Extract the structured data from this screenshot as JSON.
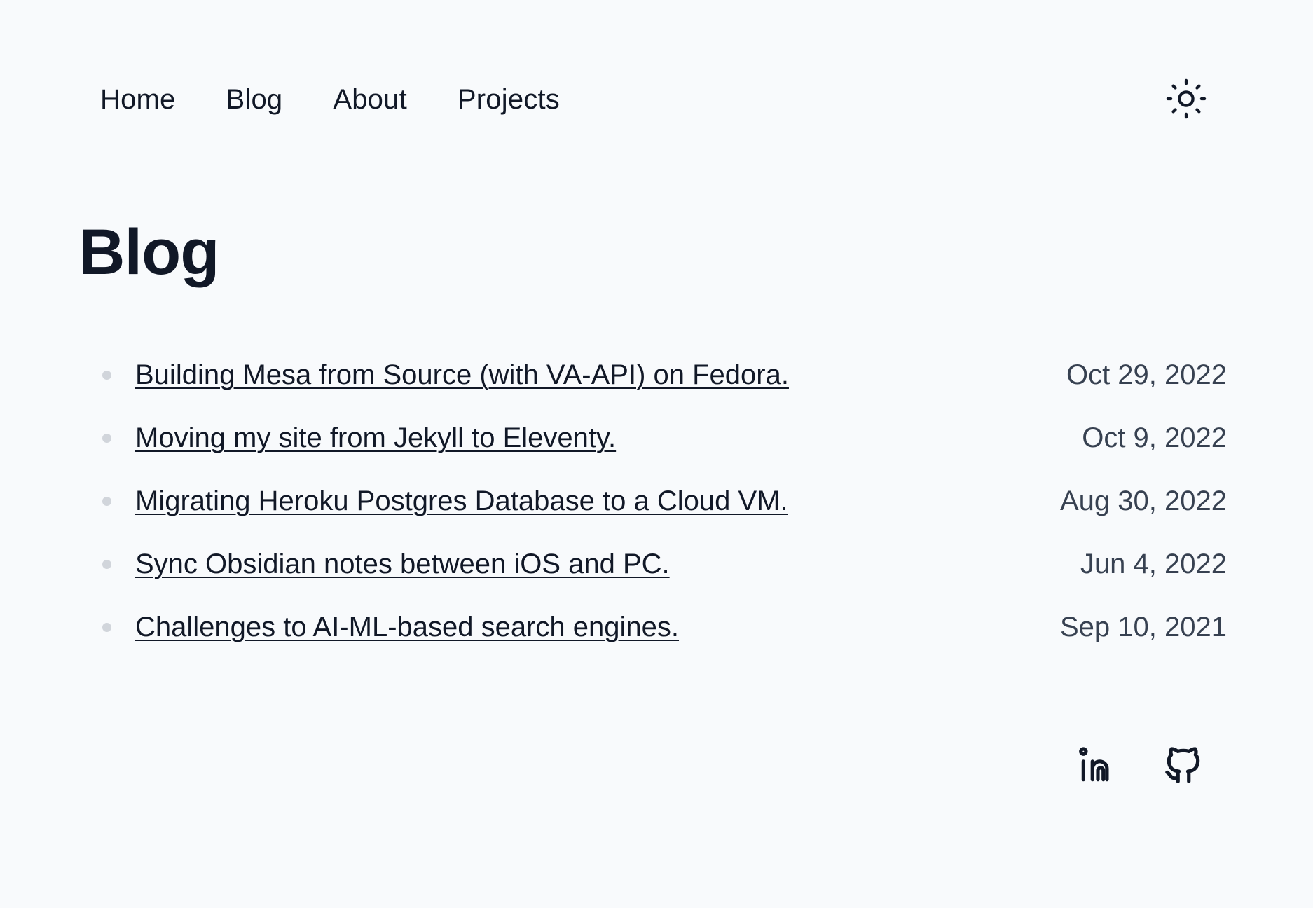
{
  "nav": {
    "items": [
      {
        "label": "Home"
      },
      {
        "label": "Blog"
      },
      {
        "label": "About"
      },
      {
        "label": "Projects"
      }
    ],
    "theme_toggle_icon": "sun-icon"
  },
  "page": {
    "title": "Blog"
  },
  "posts": [
    {
      "title": "Building Mesa from Source (with VA-API) on Fedora.",
      "date": "Oct 29, 2022"
    },
    {
      "title": "Moving my site from Jekyll to Eleventy.",
      "date": "Oct 9, 2022"
    },
    {
      "title": "Migrating Heroku Postgres Database to a Cloud VM.",
      "date": "Aug 30, 2022"
    },
    {
      "title": "Sync Obsidian notes between iOS and PC.",
      "date": "Jun 4, 2022"
    },
    {
      "title": "Challenges to AI-ML-based search engines.",
      "date": "Sep 10, 2021"
    }
  ],
  "footer": {
    "social_icons": [
      "linkedin-icon",
      "github-icon"
    ]
  },
  "colors": {
    "background": "#f8fafc",
    "text": "#111827",
    "muted_text": "#374151",
    "bullet": "#d1d5db"
  }
}
